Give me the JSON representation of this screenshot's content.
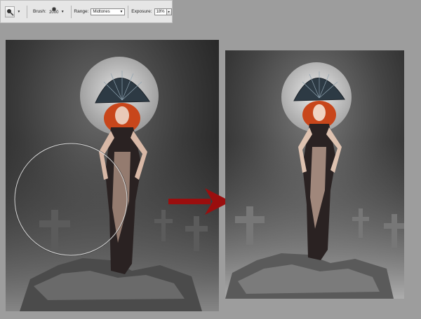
{
  "toolbar": {
    "tool_icon": "dodge-tool-icon",
    "brush_label": "Brush:",
    "brush_size": "2000",
    "range_label": "Range:",
    "range_value": "Midtones",
    "exposure_label": "Exposure:",
    "exposure_value": "18%"
  },
  "images": {
    "before_label": "",
    "after_label": ""
  },
  "colors": {
    "background": "#9d9d9d",
    "arrow": "#9b0e0e",
    "hair": "#c8461b",
    "brush_cursor": "#d8d8d8"
  },
  "icons": {
    "arrow": "red-arrow-icon",
    "brush_cursor": "circle-brush-cursor-icon"
  }
}
